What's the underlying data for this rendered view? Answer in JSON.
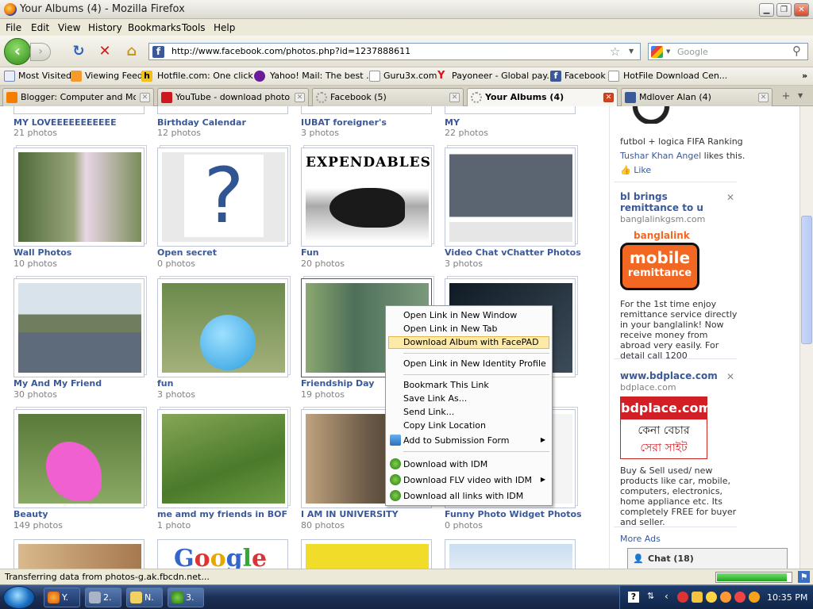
{
  "window": {
    "title": "Your Albums (4) - Mozilla Firefox"
  },
  "menu": [
    "File",
    "Edit",
    "View",
    "History",
    "Bookmarks",
    "Tools",
    "Help"
  ],
  "nav": {
    "url": "http://www.facebook.com/photos.php?id=1237888611",
    "search_placeholder": "Google"
  },
  "bookmarks": [
    "Most Visited",
    "Viewing Feed",
    "Hotfile.com: One click ...",
    "Yahoo! Mail: The best ...",
    "Guru3x.com",
    "Payoneer - Global pay...",
    "Facebook",
    "HotFile Download Cen..."
  ],
  "tabs": [
    {
      "label": "Blogger: Computer and Mo...",
      "color": "#f57d00"
    },
    {
      "label": "YouTube - download photo ...",
      "color": "#cc181e"
    },
    {
      "label": "Facebook (5)",
      "color": "#999999"
    },
    {
      "label": "Your Albums (4)",
      "color": "#999999",
      "active": true
    },
    {
      "label": "Mdlover Alan (4)",
      "color": "#3b5998"
    }
  ],
  "albums_partial_top": [
    {
      "name": "MY LOVEEEEEEEEEEE",
      "count": "21 photos"
    },
    {
      "name": "Birthday Calendar",
      "count": "12 photos"
    },
    {
      "name": "IUBAT foreigner's",
      "count": "3 photos"
    },
    {
      "name": "MY",
      "count": "22 photos"
    }
  ],
  "albums": [
    {
      "name": "Wall Photos",
      "count": "10 photos",
      "bg": "#7a8c5a"
    },
    {
      "name": "Open secret",
      "count": "0 photos",
      "bg": "#e9e9e9"
    },
    {
      "name": "Fun",
      "count": "20 photos",
      "bg": "#ffffff",
      "caption": "EXPENDABLES"
    },
    {
      "name": "Video Chat vChatter Photos",
      "count": "3 photos",
      "bg": "#6a7684"
    },
    {
      "name": "My And My Friend",
      "count": "30 photos",
      "bg": "#8b9c7a"
    },
    {
      "name": "fun",
      "count": "3 photos",
      "bg": "#6c8a5a"
    },
    {
      "name": "Friendship Day",
      "count": "19 photos",
      "bg": "#5d7f6a"
    },
    {
      "name": "",
      "count": "",
      "bg": "#1d2a3a"
    },
    {
      "name": "Beauty",
      "count": "149 photos",
      "bg": "#5a8a4a"
    },
    {
      "name": "me amd my friends in BOF",
      "count": "1 photo",
      "bg": "#5f8a3f"
    },
    {
      "name": "I AM IN UNIVERSITY",
      "count": "80 photos",
      "bg": "#6b5a48"
    },
    {
      "name": "Funny Photo Widget Photos",
      "count": "0 photos",
      "bg": "#dddddd"
    }
  ],
  "sidebar": {
    "top_text": "futbol + logica FIFA Ranking",
    "likes_name": "Tushar Khan Angel",
    "likes_suffix": " likes this.",
    "like_label": "Like",
    "ads": [
      {
        "title": "bl brings remittance to u",
        "host": "banglalinkgsm.com",
        "brand": "banglalink",
        "banner_line1": "mobile",
        "banner_line2": "remittance",
        "text": "For the 1st time enjoy remittance service directly in your banglalink! Now receive money from abroad very easily. For detail call 1200"
      },
      {
        "title": "www.bdplace.com",
        "host": "bdplace.com",
        "banner_line1": "bdplace.com",
        "banner_line2": "কেনা বেচার",
        "banner_line3": "সেরা সাইট",
        "text": "Buy & Sell used/ new products like car, mobile, computers, electronics, home appliance etc. Its completely FREE for buyer and seller."
      }
    ],
    "more_ads": "More Ads",
    "chat": "Chat (18)"
  },
  "context_menu": {
    "items": [
      "Open Link in New Window",
      "Open Link in New Tab",
      "Download Album with FacePAD",
      "Open Link in New Identity Profile",
      "Bookmark This Link",
      "Save Link As...",
      "Send Link...",
      "Copy Link Location",
      "Add to Submission Form",
      "Download with IDM",
      "Download FLV video with IDM",
      "Download all links with IDM"
    ]
  },
  "status": {
    "text": "Transferring data from photos-g.ak.fbcdn.net...",
    "progress": 0.95
  },
  "taskbar": {
    "buttons": [
      "Y.",
      "2.",
      "N.",
      "3."
    ],
    "clock": "10:35 PM"
  },
  "colors": {
    "fb_blue": "#3b5998",
    "menu_highlight": "#fde9a8"
  }
}
